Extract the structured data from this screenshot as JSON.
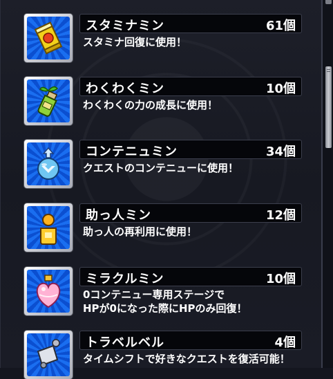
{
  "items": [
    {
      "name": "スタミナミン",
      "count": "61個",
      "desc": "スタミナ回復に使用！",
      "icon": "stamina-can-icon"
    },
    {
      "name": "わくわくミン",
      "count": "10個",
      "desc": "わくわくの力の成長に使用！",
      "icon": "sprout-bottle-icon"
    },
    {
      "name": "コンテニュミン",
      "count": "34個",
      "desc": "クエストのコンテニューに使用！",
      "icon": "continue-potion-icon"
    },
    {
      "name": "助っ人ミン",
      "count": "12個",
      "desc": "助っ人の再利用に使用！",
      "icon": "helper-figure-icon"
    },
    {
      "name": "ミラクルミン",
      "count": "10個",
      "desc": "0コンテニュー専用ステージで\nHPが0になった際にHPのみ回復！",
      "icon": "heart-bottle-icon"
    },
    {
      "name": "トラベルベル",
      "count": "4個",
      "desc": "タイムシフトで好きなクエストを復活可能！",
      "icon": "travel-bell-icon"
    }
  ]
}
